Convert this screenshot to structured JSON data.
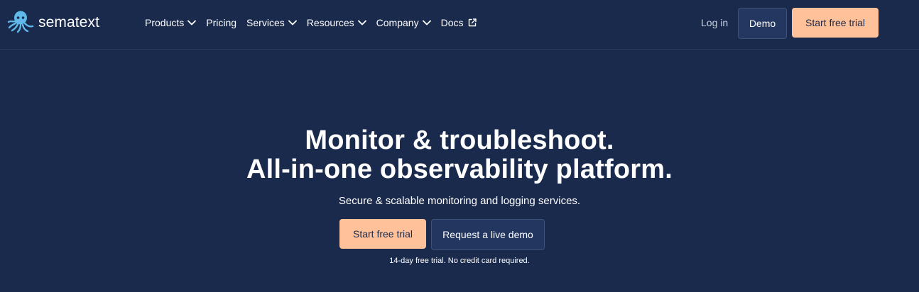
{
  "colors": {
    "background": "#1a2a4d",
    "accent": "#ffc199",
    "logo_blue": "#5fb8e8",
    "secondary_button": "#223660"
  },
  "header": {
    "logo_text": "sematext",
    "logo_icon": "octopus-icon",
    "nav": [
      {
        "label": "Products",
        "icon": "chevron-down-icon"
      },
      {
        "label": "Pricing"
      },
      {
        "label": "Services",
        "icon": "chevron-down-icon"
      },
      {
        "label": "Resources",
        "icon": "chevron-down-icon"
      },
      {
        "label": "Company",
        "icon": "chevron-down-icon"
      },
      {
        "label": "Docs",
        "icon": "external-link-icon"
      }
    ],
    "login_label": "Log in",
    "demo_label": "Demo",
    "trial_label": "Start free trial"
  },
  "hero": {
    "title_line1": "Monitor & troubleshoot.",
    "title_line2": "All-in-one observability platform.",
    "subtitle": "Secure & scalable monitoring and logging services.",
    "primary_cta": "Start free trial",
    "secondary_cta": "Request a live demo",
    "note": "14-day free trial. No credit card required."
  }
}
